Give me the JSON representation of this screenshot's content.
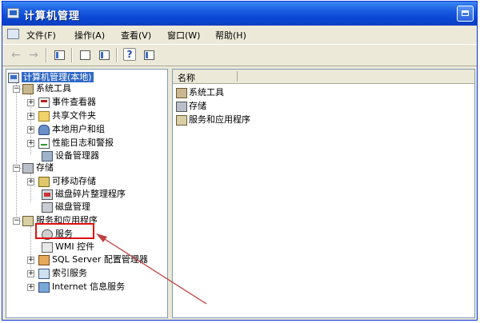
{
  "window": {
    "title": "计算机管理"
  },
  "menu": [
    {
      "label": "文件(F)"
    },
    {
      "label": "操作(A)"
    },
    {
      "label": "查看(V)"
    },
    {
      "label": "窗口(W)"
    },
    {
      "label": "帮助(H)"
    }
  ],
  "toolbar": {
    "back_icon": "back-arrow-icon",
    "forward_icon": "forward-arrow-icon",
    "help_glyph": "?"
  },
  "tree": {
    "root": "计算机管理(本地)",
    "system_tools": {
      "label": "系统工具",
      "children": [
        "事件查看器",
        "共享文件夹",
        "本地用户和组",
        "性能日志和警报",
        "设备管理器"
      ]
    },
    "storage": {
      "label": "存储",
      "children": [
        "可移动存储",
        "磁盘碎片整理程序",
        "磁盘管理"
      ]
    },
    "services_apps": {
      "label": "服务和应用程序",
      "children": [
        "服务",
        "WMI 控件",
        "SQL Server 配置管理器",
        "索引服务",
        "Internet 信息服务"
      ]
    }
  },
  "list": {
    "column_name": "名称",
    "items": [
      "系统工具",
      "存储",
      "服务和应用程序"
    ]
  },
  "colors": {
    "titlebar": "#0a46d6",
    "selection": "#316ac5",
    "annotation": "#e01010"
  }
}
